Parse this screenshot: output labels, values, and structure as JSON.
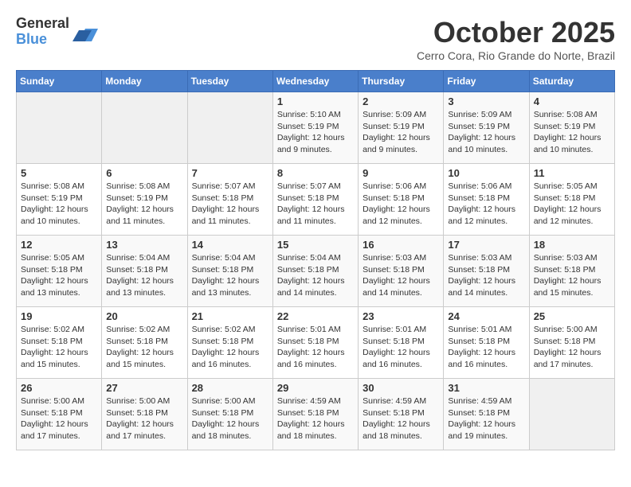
{
  "logo": {
    "general": "General",
    "blue": "Blue"
  },
  "header": {
    "month": "October 2025",
    "location": "Cerro Cora, Rio Grande do Norte, Brazil"
  },
  "weekdays": [
    "Sunday",
    "Monday",
    "Tuesday",
    "Wednesday",
    "Thursday",
    "Friday",
    "Saturday"
  ],
  "weeks": [
    [
      {
        "day": "",
        "info": ""
      },
      {
        "day": "",
        "info": ""
      },
      {
        "day": "",
        "info": ""
      },
      {
        "day": "1",
        "info": "Sunrise: 5:10 AM\nSunset: 5:19 PM\nDaylight: 12 hours\nand 9 minutes."
      },
      {
        "day": "2",
        "info": "Sunrise: 5:09 AM\nSunset: 5:19 PM\nDaylight: 12 hours\nand 9 minutes."
      },
      {
        "day": "3",
        "info": "Sunrise: 5:09 AM\nSunset: 5:19 PM\nDaylight: 12 hours\nand 10 minutes."
      },
      {
        "day": "4",
        "info": "Sunrise: 5:08 AM\nSunset: 5:19 PM\nDaylight: 12 hours\nand 10 minutes."
      }
    ],
    [
      {
        "day": "5",
        "info": "Sunrise: 5:08 AM\nSunset: 5:19 PM\nDaylight: 12 hours\nand 10 minutes."
      },
      {
        "day": "6",
        "info": "Sunrise: 5:08 AM\nSunset: 5:19 PM\nDaylight: 12 hours\nand 11 minutes."
      },
      {
        "day": "7",
        "info": "Sunrise: 5:07 AM\nSunset: 5:18 PM\nDaylight: 12 hours\nand 11 minutes."
      },
      {
        "day": "8",
        "info": "Sunrise: 5:07 AM\nSunset: 5:18 PM\nDaylight: 12 hours\nand 11 minutes."
      },
      {
        "day": "9",
        "info": "Sunrise: 5:06 AM\nSunset: 5:18 PM\nDaylight: 12 hours\nand 12 minutes."
      },
      {
        "day": "10",
        "info": "Sunrise: 5:06 AM\nSunset: 5:18 PM\nDaylight: 12 hours\nand 12 minutes."
      },
      {
        "day": "11",
        "info": "Sunrise: 5:05 AM\nSunset: 5:18 PM\nDaylight: 12 hours\nand 12 minutes."
      }
    ],
    [
      {
        "day": "12",
        "info": "Sunrise: 5:05 AM\nSunset: 5:18 PM\nDaylight: 12 hours\nand 13 minutes."
      },
      {
        "day": "13",
        "info": "Sunrise: 5:04 AM\nSunset: 5:18 PM\nDaylight: 12 hours\nand 13 minutes."
      },
      {
        "day": "14",
        "info": "Sunrise: 5:04 AM\nSunset: 5:18 PM\nDaylight: 12 hours\nand 13 minutes."
      },
      {
        "day": "15",
        "info": "Sunrise: 5:04 AM\nSunset: 5:18 PM\nDaylight: 12 hours\nand 14 minutes."
      },
      {
        "day": "16",
        "info": "Sunrise: 5:03 AM\nSunset: 5:18 PM\nDaylight: 12 hours\nand 14 minutes."
      },
      {
        "day": "17",
        "info": "Sunrise: 5:03 AM\nSunset: 5:18 PM\nDaylight: 12 hours\nand 14 minutes."
      },
      {
        "day": "18",
        "info": "Sunrise: 5:03 AM\nSunset: 5:18 PM\nDaylight: 12 hours\nand 15 minutes."
      }
    ],
    [
      {
        "day": "19",
        "info": "Sunrise: 5:02 AM\nSunset: 5:18 PM\nDaylight: 12 hours\nand 15 minutes."
      },
      {
        "day": "20",
        "info": "Sunrise: 5:02 AM\nSunset: 5:18 PM\nDaylight: 12 hours\nand 15 minutes."
      },
      {
        "day": "21",
        "info": "Sunrise: 5:02 AM\nSunset: 5:18 PM\nDaylight: 12 hours\nand 16 minutes."
      },
      {
        "day": "22",
        "info": "Sunrise: 5:01 AM\nSunset: 5:18 PM\nDaylight: 12 hours\nand 16 minutes."
      },
      {
        "day": "23",
        "info": "Sunrise: 5:01 AM\nSunset: 5:18 PM\nDaylight: 12 hours\nand 16 minutes."
      },
      {
        "day": "24",
        "info": "Sunrise: 5:01 AM\nSunset: 5:18 PM\nDaylight: 12 hours\nand 16 minutes."
      },
      {
        "day": "25",
        "info": "Sunrise: 5:00 AM\nSunset: 5:18 PM\nDaylight: 12 hours\nand 17 minutes."
      }
    ],
    [
      {
        "day": "26",
        "info": "Sunrise: 5:00 AM\nSunset: 5:18 PM\nDaylight: 12 hours\nand 17 minutes."
      },
      {
        "day": "27",
        "info": "Sunrise: 5:00 AM\nSunset: 5:18 PM\nDaylight: 12 hours\nand 17 minutes."
      },
      {
        "day": "28",
        "info": "Sunrise: 5:00 AM\nSunset: 5:18 PM\nDaylight: 12 hours\nand 18 minutes."
      },
      {
        "day": "29",
        "info": "Sunrise: 4:59 AM\nSunset: 5:18 PM\nDaylight: 12 hours\nand 18 minutes."
      },
      {
        "day": "30",
        "info": "Sunrise: 4:59 AM\nSunset: 5:18 PM\nDaylight: 12 hours\nand 18 minutes."
      },
      {
        "day": "31",
        "info": "Sunrise: 4:59 AM\nSunset: 5:18 PM\nDaylight: 12 hours\nand 19 minutes."
      },
      {
        "day": "",
        "info": ""
      }
    ]
  ]
}
